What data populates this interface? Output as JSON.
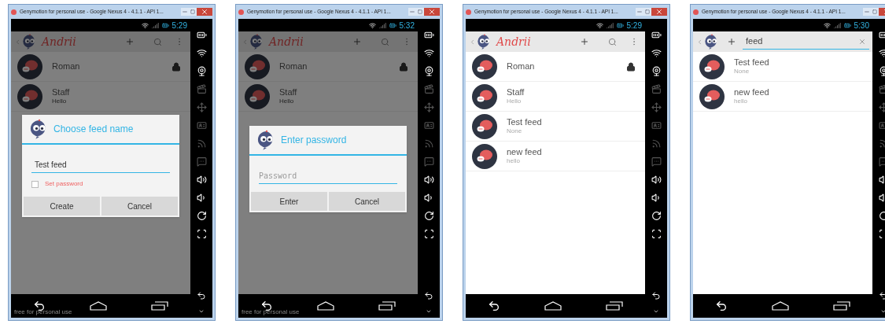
{
  "windows": [
    {
      "title": "Genymotion for personal use - Google Nexus 4 - 4.1.1 - API 1...",
      "time": "5:29",
      "dimmed": true,
      "app_bar": {
        "kind": "actions",
        "name": "Andrii"
      },
      "feeds": [
        {
          "name": "Roman",
          "locked": true
        },
        {
          "name": "Staff",
          "subtitle": "Hello",
          "locked": false
        }
      ],
      "dialog": {
        "kind": "name",
        "title": "Choose feed name",
        "field": {
          "value": "Test feed"
        },
        "checkbox": {
          "label": "Set password",
          "checked": false
        },
        "buttons": [
          "Create",
          "Cancel"
        ]
      },
      "watermark": "free for personal use"
    },
    {
      "title": "Genymotion for personal use - Google Nexus 4 - 4.1.1 - API 1...",
      "time": "5:32",
      "dimmed": true,
      "app_bar": {
        "kind": "actions",
        "name": "Andrii"
      },
      "feeds": [
        {
          "name": "Roman",
          "locked": true
        },
        {
          "name": "Staff",
          "subtitle": "Hello",
          "locked": false
        }
      ],
      "dialog": {
        "kind": "password",
        "title": "Enter password",
        "field": {
          "placeholder": "Password"
        },
        "buttons": [
          "Enter",
          "Cancel"
        ]
      },
      "watermark": "free for personal use"
    },
    {
      "title": "Genymotion for personal use - Google Nexus 4 - 4.1.1 - API 1...",
      "time": "5:29",
      "dimmed": false,
      "app_bar": {
        "kind": "actions",
        "name": "Andrii"
      },
      "feeds": [
        {
          "name": "Roman",
          "locked": true
        },
        {
          "name": "Staff",
          "subtitle": "Hello",
          "locked": false
        },
        {
          "name": "Test feed",
          "subtitle": "None",
          "locked": false
        },
        {
          "name": "new feed",
          "subtitle": "hello",
          "locked": false
        }
      ]
    },
    {
      "title": "Genymotion for personal use - Google Nexus 4 - 4.1.1 - API 1...",
      "time": "5:30",
      "dimmed": false,
      "app_bar": {
        "kind": "search",
        "query": "feed"
      },
      "feeds": [
        {
          "name": "Test feed",
          "subtitle": "None",
          "locked": false
        },
        {
          "name": "new feed",
          "subtitle": "hello",
          "locked": false
        }
      ]
    }
  ]
}
